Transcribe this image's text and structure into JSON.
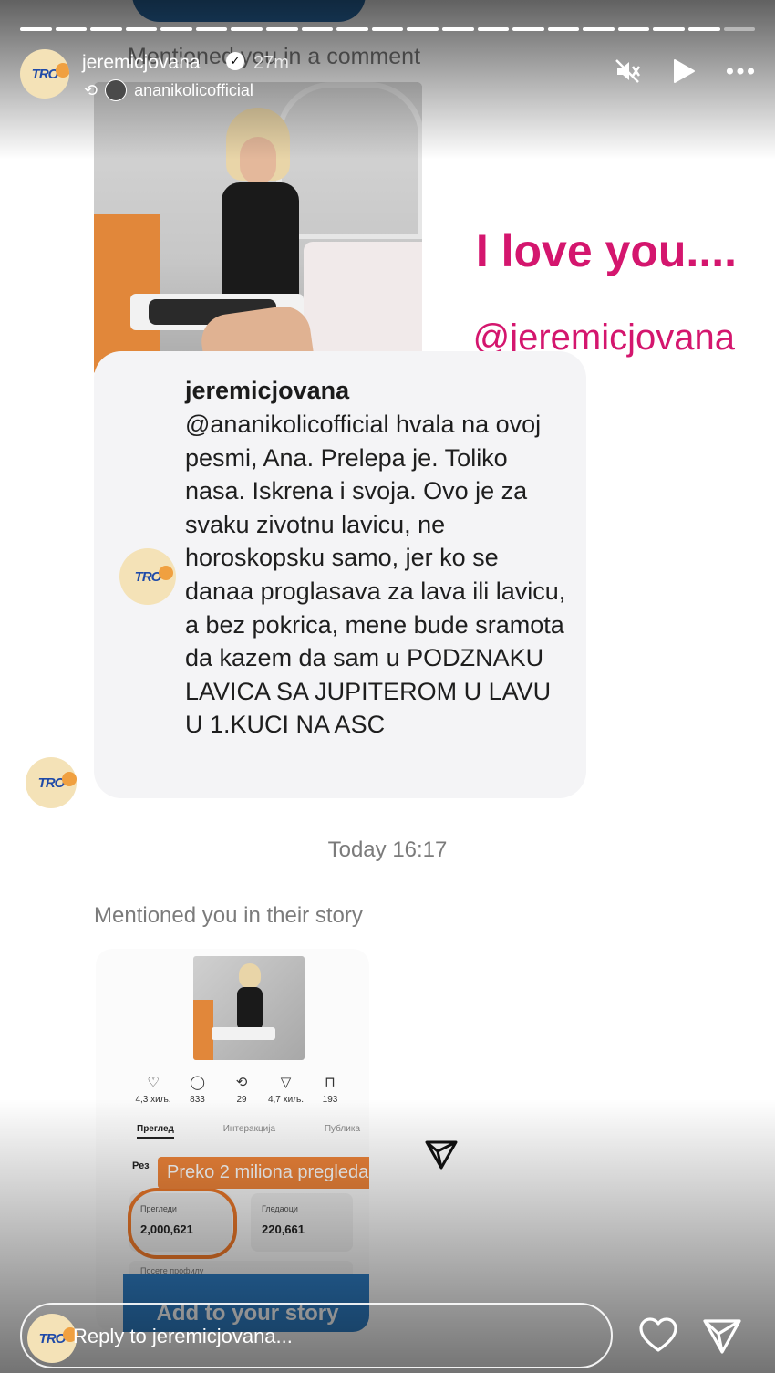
{
  "story": {
    "progress_segments": 21,
    "progress_done": 20,
    "username": "jeremicjovana",
    "time_ago": "27m",
    "repost_from": "ananikolicofficial"
  },
  "header_icons": {
    "mute": "muted-speaker-icon",
    "play": "play-icon",
    "more": "more-dots-icon"
  },
  "top_note": "Mentioned you in a comment",
  "overlay": {
    "love": "I love you....",
    "mention": "@jeremicjovana"
  },
  "comment": {
    "username": "jeremicjovana",
    "text": "@ananikolicofficial hvala na ovoj pesmi, Ana. Prelepa je. Toliko nasa. Iskrena i svoja. Ovo je za svaku zivotnu lavicu, ne horoskopsku samo, jer ko se danaa proglasava za lava ili lavicu, a bez pokrica, mene bude sramota da kazem da sam u PODZNAKU LAVICA SA JUPITEROM U LAVU U 1.KUCI NA ASC"
  },
  "logo": {
    "text": "TRO"
  },
  "timestamp": "Today 16:17",
  "mentioned_story": "Mentioned you in their story",
  "embedded_story": {
    "stats": [
      {
        "icon": "heart-icon",
        "glyph": "♡",
        "value": "4,3 хиљ."
      },
      {
        "icon": "comment-icon",
        "glyph": "◯",
        "value": "833"
      },
      {
        "icon": "repost-icon",
        "glyph": "⟲",
        "value": "29"
      },
      {
        "icon": "share-icon",
        "glyph": "▽",
        "value": "4,7 хиљ."
      },
      {
        "icon": "bookmark-icon",
        "glyph": "⊓",
        "value": "193"
      }
    ],
    "tabs": [
      "Преглед",
      "Интеракција",
      "Публика"
    ],
    "section": "Рез",
    "highlight": "Preko 2 miliona pregleda.",
    "metric1_label": "Прегледи",
    "metric1_value": "2,000,621",
    "metric2_label": "Гледаоци",
    "metric2_value": "220,661",
    "faded_row": "Посете профилу",
    "add_button": "Add to your story"
  },
  "reply": {
    "placeholder": "Reply to jeremicjovana..."
  },
  "colors": {
    "accent_pink": "#d4166e",
    "highlight_orange": "#f0853a",
    "button_blue": "#2f7fc7"
  }
}
